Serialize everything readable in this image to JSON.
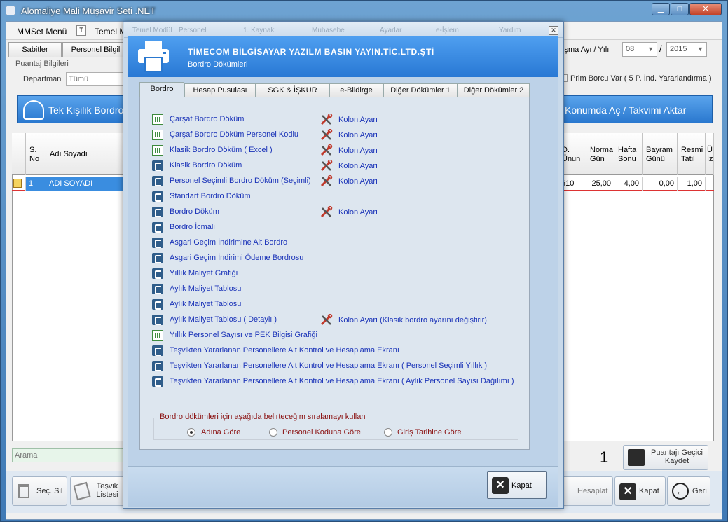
{
  "app": {
    "title": "Alomaliye Mali Müşavir Seti .NET"
  },
  "window_controls": {
    "minimize": "▁",
    "maximize": "□",
    "close": "✕"
  },
  "menu": [
    "MMSet Menü",
    "Temel M"
  ],
  "main_tabs": [
    "Sabitler",
    "Personel Bilgil"
  ],
  "puantaj": {
    "group_label": "Puantaj Bilgileri",
    "department_label": "Departman",
    "department_value": "Tümü"
  },
  "period": {
    "label": "lışma Ayı / Yılı",
    "month": "08",
    "separator": "/",
    "year": "2015"
  },
  "prim": {
    "label": "Prim Borcu Var ( 5 P. İnd. Yararlandırma )"
  },
  "bands": {
    "left": "Tek Kişilik Bordro",
    "right": "Konumda Aç / Takvimi Aktar"
  },
  "grid": {
    "headers": [
      "S. No",
      "Adı Soyadı",
      "D. Ünun",
      "Norma Gün",
      "Hafta Sonu",
      "Bayram Günü",
      "Resmi Tatil",
      "Ü İz"
    ],
    "row": [
      "1",
      "ADI SOYADI",
      "610",
      "25,00",
      "4,00",
      "0,00",
      "1,00"
    ]
  },
  "search": {
    "placeholder": "Arama"
  },
  "footer": {
    "count": "1",
    "save_temp": "Puantajı Geçici Kaydet",
    "sec_sil": "Seç. Sil",
    "tesvik": "Teşvik Listesi",
    "hesaplat": "Hesaplat",
    "kapat": "Kapat",
    "geri": "Geri"
  },
  "dialog": {
    "title_faint": [
      "Temel Modül",
      "Personel",
      "1. Kaynak",
      "Muhasebe",
      "Ayarlar",
      "e-İşlem",
      "Yardım"
    ],
    "company": "TİMECOM BİLGİSAYAR YAZILM BASIN YAYIN.TİC.LTD.ŞTİ",
    "subtitle": "Bordro Dökümleri",
    "tabs": [
      "Bordro",
      "Hesap Pusulası",
      "SGK  &  İŞKUR",
      "e-Bildirge",
      "Diğer Dökümler 1",
      "Diğer Dökümler 2"
    ],
    "items": [
      {
        "label": "Çarşaf Bordro Döküm",
        "icon": "excel-icon",
        "kolon": "Kolon Ayarı"
      },
      {
        "label": "Çarşaf Bordro Döküm Personel Kodlu",
        "icon": "excel-icon",
        "kolon": "Kolon Ayarı"
      },
      {
        "label": "Klasik Bordro Döküm ( Excel )",
        "icon": "excel-icon",
        "kolon": "Kolon Ayarı"
      },
      {
        "label": "Klasik Bordro Döküm",
        "icon": "report-icon",
        "kolon": "Kolon Ayarı"
      },
      {
        "label": "Personel Seçimli Bordro Döküm (Seçimli)",
        "icon": "report-icon",
        "kolon": "Kolon Ayarı"
      },
      {
        "label": "Standart Bordro Döküm",
        "icon": "report-icon",
        "kolon": ""
      },
      {
        "label": "Bordro Döküm",
        "icon": "report-icon",
        "kolon": "Kolon Ayarı"
      },
      {
        "label": "Bordro İcmali",
        "icon": "report-icon",
        "kolon": ""
      },
      {
        "label": "Asgari Geçim İndirimine Ait Bordro",
        "icon": "report-icon",
        "kolon": ""
      },
      {
        "label": "Asgari Geçim İndirimi Ödeme Bordrosu",
        "icon": "report-icon",
        "kolon": ""
      },
      {
        "label": "Yıllık Maliyet Grafiği",
        "icon": "report-icon",
        "kolon": ""
      },
      {
        "label": "Aylık Maliyet Tablosu",
        "icon": "report-icon",
        "kolon": ""
      },
      {
        "label": "Aylık Maliyet Tablosu",
        "icon": "report-icon",
        "kolon": ""
      },
      {
        "label": "Aylık Maliyet Tablosu ( Detaylı )",
        "icon": "report-icon",
        "kolon": "Kolon Ayarı (Klasik bordro ayarını değiştirir)"
      },
      {
        "label": "Yıllık Personel Sayısı ve PEK Bilgisi Grafiği",
        "icon": "excel-icon",
        "kolon": ""
      },
      {
        "label": "Teşvikten Yararlanan Personellere Ait Kontrol ve Hesaplama Ekranı",
        "icon": "report-icon",
        "kolon": ""
      },
      {
        "label": "Teşvikten Yararlanan Personellere Ait Kontrol ve Hesaplama Ekranı ( Personel Seçimli Yıllık )",
        "icon": "report-icon",
        "kolon": ""
      },
      {
        "label": "Teşvikten Yararlanan Personellere Ait Kontrol ve Hesaplama Ekranı ( Aylık Personel Sayısı Dağılımı )",
        "icon": "report-icon",
        "kolon": ""
      }
    ],
    "sort": {
      "legend": "Bordro dökümleri için aşağıda belirteceğim sıralamayı kullan",
      "options": [
        "Adına Göre",
        "Personel Koduna Göre",
        "Giriş Tarihine Göre"
      ],
      "selected": "Adına Göre"
    },
    "close_label": "Kapat"
  }
}
